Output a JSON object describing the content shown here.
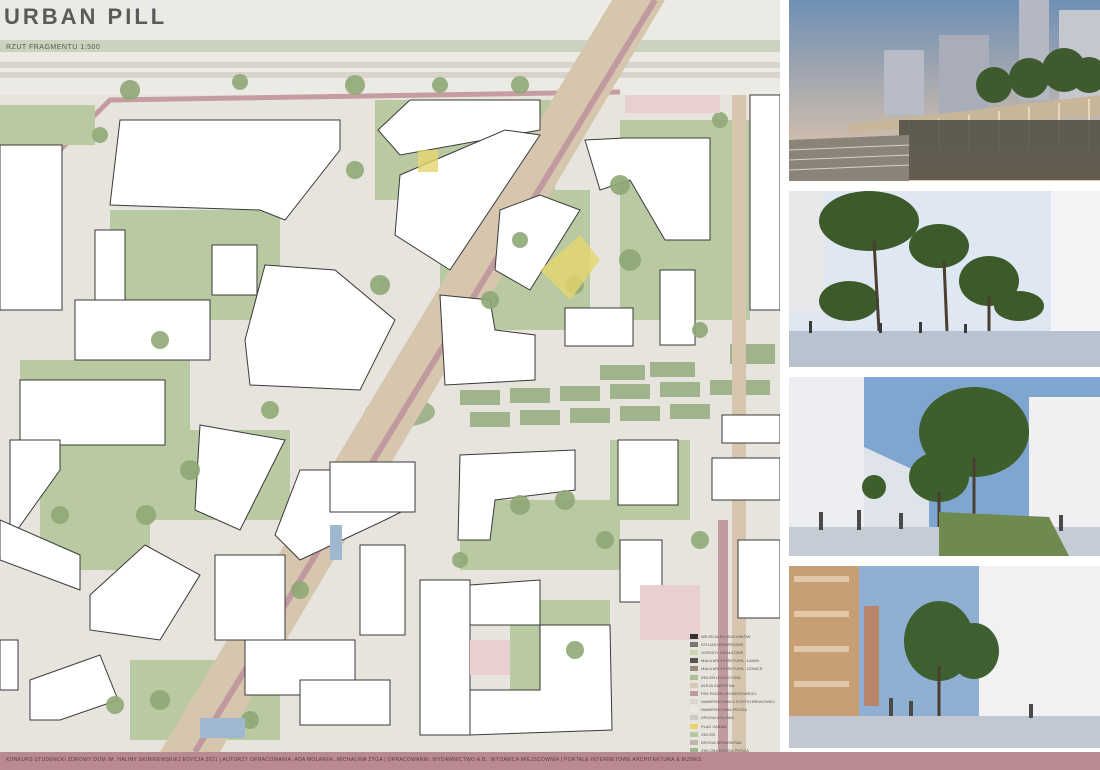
{
  "header": {
    "title": "URBAN PILL",
    "scale_label": "RZUT FRAGMENTU 1:500"
  },
  "legend": {
    "items": [
      {
        "label": "WEJŚCIA DO BUDYNKÓW",
        "color": "#333333"
      },
      {
        "label": "STOJAKI ROWEROWE",
        "color": "#777777"
      },
      {
        "label": "OGRODY DZIAŁKOWE",
        "color": "#c7d6b0"
      },
      {
        "label": "MAŁA ARCHITEKTURA - ŁAWKI",
        "color": "#555555"
      },
      {
        "label": "MAŁA ARCHITEKTURA - DONICE",
        "color": "#9a8a7a"
      },
      {
        "label": "ZIELEŃ IZOLACYJNA",
        "color": "#a8bf8f"
      },
      {
        "label": "ALEJA ZWROTNA",
        "color": "#d9c9b4"
      },
      {
        "label": "PAS RUCHU ROWEROWEGO",
        "color": "#c19a9f"
      },
      {
        "label": "NAWIERZCHNIA Z KOSTKI BRUKOWEJ",
        "color": "#d9d6cf"
      },
      {
        "label": "NAWIERZCHNIA PIESZA",
        "color": "#ece9e2"
      },
      {
        "label": "DROGA KOŁOWA",
        "color": "#cfc9bf"
      },
      {
        "label": "PLAC ZABAW",
        "color": "#e6d56e"
      },
      {
        "label": "ZIELEŃ",
        "color": "#b5c9a0"
      },
      {
        "label": "DROGA SERWISOWA",
        "color": "#bfb6a8"
      },
      {
        "label": "ZIELONA DROGA PIESZA",
        "color": "#9fb48c"
      }
    ]
  },
  "footer": {
    "text": "KONKURS STUDENCKI ZDROWY DOM IM. HALINY SKIBNIEWSKIEJ EDYCJA 2021 | AUTORZY OPRACOWANIA: ADA MOLAREK, MICHALINA ŻYGA | OPRACOWANIE: WYDAWNICTWO A.B.: WYDAWCA MIEJSCOWNIA | PORTALE INTERNETOWE ARCHITEKTURA & BIZNES"
  },
  "colors": {
    "accent": "#b98b91",
    "grass": "#b5c9a0",
    "paving": "#e6e3dc",
    "building": "#ffffff",
    "bike_lane": "#c19a9f"
  },
  "renders": [
    "railway-terrace-render",
    "green-street-render",
    "tree-alley-render",
    "pedestrian-street-render"
  ]
}
